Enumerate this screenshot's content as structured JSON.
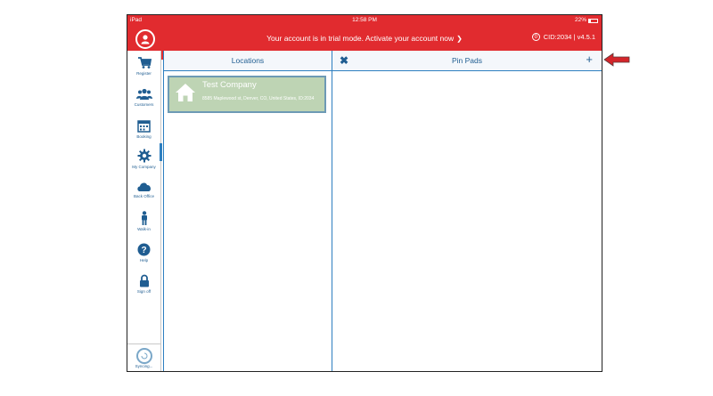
{
  "status_bar": {
    "device": "iPad",
    "time": "12:58 PM",
    "battery": "22%"
  },
  "top_bar": {
    "trial_message": "Your account is in trial mode. Activate your account now",
    "trial_chevron": "❯",
    "badge_count": "0",
    "cid_version": "CID:2034  |  v4.5.1"
  },
  "sidebar": {
    "items": [
      {
        "label": "Register",
        "icon": "cart-icon"
      },
      {
        "label": "Customers",
        "icon": "customers-icon"
      },
      {
        "label": "Booking",
        "icon": "calendar-icon"
      },
      {
        "label": "My Company",
        "icon": "gear-icon"
      },
      {
        "label": "Back Office",
        "icon": "cloud-icon"
      },
      {
        "label": "Walk-in",
        "icon": "person-icon"
      },
      {
        "label": "Help",
        "icon": "help-icon"
      },
      {
        "label": "Sign off",
        "icon": "lock-icon"
      }
    ],
    "sync_label": "Syncing..."
  },
  "locations": {
    "title": "Locations",
    "items": [
      {
        "name": "Test Company",
        "address": "8585 Maplewood st, Denver, CO, United States, ID:2034"
      }
    ]
  },
  "pin_pads": {
    "title": "Pin Pads",
    "close_symbol": "✖",
    "add_symbol": "+"
  },
  "colors": {
    "brand_red": "#e12b2f",
    "nav_blue": "#1f5d91",
    "card_green": "#bed4b4",
    "arrow_red": "#d4252a"
  }
}
